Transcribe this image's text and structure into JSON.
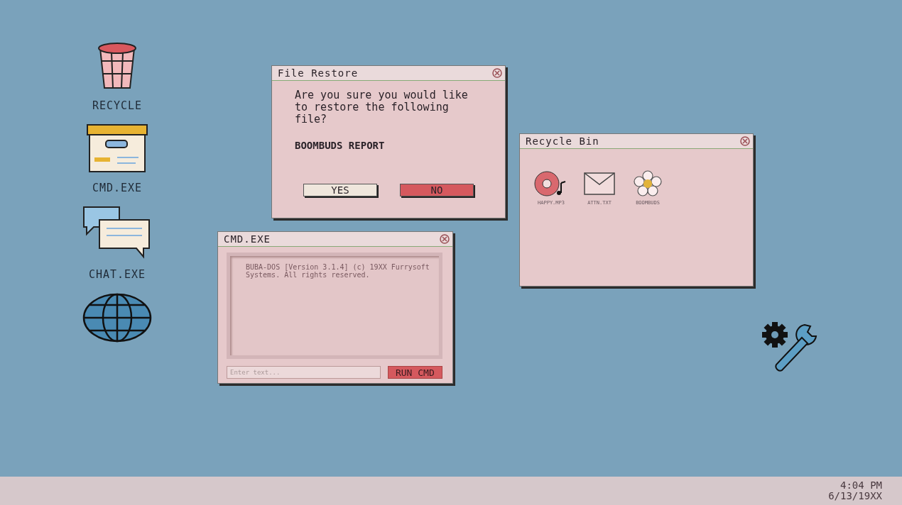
{
  "desktop_icons": [
    {
      "kind": "bin",
      "label": "RECYCLE"
    },
    {
      "kind": "box",
      "label": "CMD.EXE"
    },
    {
      "kind": "chat",
      "label": "CHAT.EXE"
    },
    {
      "kind": "globe"
    }
  ],
  "file_restore": {
    "title": "File Restore",
    "message": "Are you sure you would like to restore the following file?",
    "filename": "BOOMBUDS REPORT",
    "buttons": [
      {
        "label": "YES",
        "kind": "confirm"
      },
      {
        "label": "NO",
        "kind": "cancel"
      }
    ]
  },
  "recycle_bin": {
    "title": "Recycle Bin",
    "files": [
      {
        "name": "HAPPY.MP3",
        "kind": "disc"
      },
      {
        "name": "ATTN.TXT",
        "kind": "mail"
      },
      {
        "name": "BOOMBUDS",
        "kind": "flower"
      }
    ]
  },
  "cmd": {
    "title": "CMD.EXE",
    "output": "BUBA-DOS [Version 3.1.4] (c) 19XX Furrysoft Systems. All rights reserved.",
    "placeholder": "Enter text...",
    "button": "RUN CMD"
  },
  "taskbar": {
    "time": "4:04 PM",
    "date": "6/13/19XX"
  }
}
